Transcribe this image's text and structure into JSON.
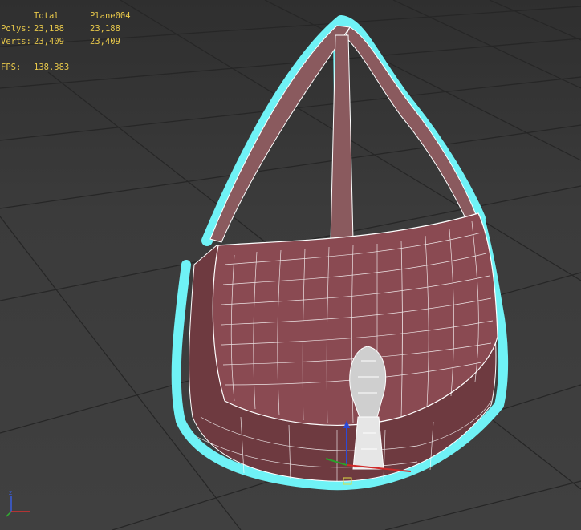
{
  "viewport": {
    "name": "perspective-viewport",
    "colors": {
      "background": "#3a3a3a",
      "grid": "#2a2a2a",
      "mesh_fill": "#7a3e44",
      "wire": "#ffffff",
      "selection": "#6ff2f6",
      "stats_text": "#e8c84a"
    }
  },
  "stats": {
    "header_total": "Total",
    "header_object": "Plane004",
    "polys_label": "Polys:",
    "polys_total": "23,188",
    "polys_object": "23,188",
    "verts_label": "Verts:",
    "verts_total": "23,409",
    "verts_object": "23,409",
    "fps_label": "FPS:",
    "fps_value": "138.383"
  },
  "gizmo": {
    "icon": "xyz-axis-tripod-icon",
    "z_label": "z",
    "x_label": "x",
    "y_label": "y"
  }
}
